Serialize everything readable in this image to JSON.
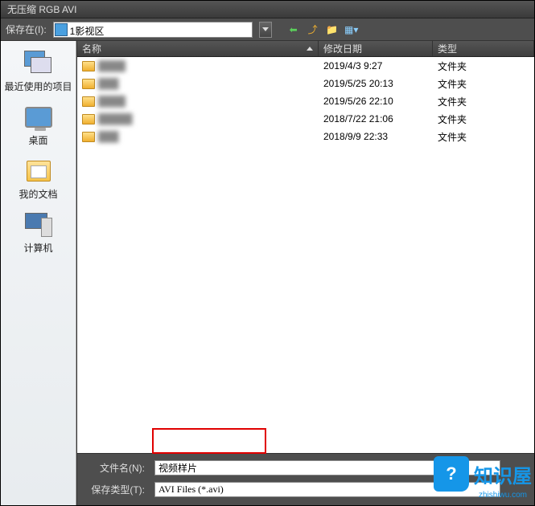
{
  "title": "无压缩 RGB AVI",
  "toolbar": {
    "save_in_label": "保存在(I):",
    "location": "1影视区",
    "icons": [
      "back-icon",
      "up-icon",
      "new-folder-icon",
      "view-icon"
    ]
  },
  "sidebar": {
    "items": [
      {
        "label": "最近使用的项目"
      },
      {
        "label": "桌面"
      },
      {
        "label": "我的文档"
      },
      {
        "label": "计算机"
      }
    ]
  },
  "columns": {
    "name": "名称",
    "modified": "修改日期",
    "type": "类型"
  },
  "rows": [
    {
      "name": "████",
      "date": "2019/4/3 9:27",
      "type": "文件夹"
    },
    {
      "name": "███",
      "date": "2019/5/25 20:13",
      "type": "文件夹"
    },
    {
      "name": "████",
      "date": "2019/5/26 22:10",
      "type": "文件夹"
    },
    {
      "name": "█████",
      "date": "2018/7/22 21:06",
      "type": "文件夹"
    },
    {
      "name": "███",
      "date": "2018/9/9 22:33",
      "type": "文件夹"
    }
  ],
  "bottom": {
    "filename_label": "文件名(N):",
    "filename_value": "视频样片",
    "filetype_label": "保存类型(T):",
    "filetype_value": "AVI Files (*.avi)"
  },
  "watermark": {
    "brand": "知识屋",
    "domain": "zhishiwu.com"
  }
}
